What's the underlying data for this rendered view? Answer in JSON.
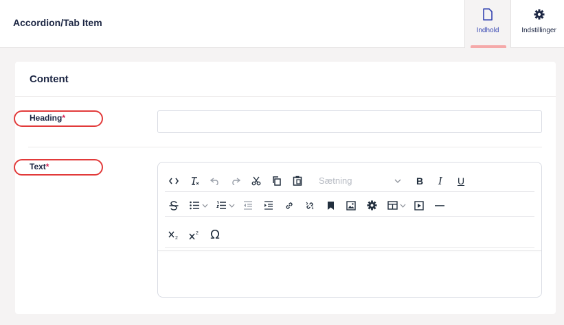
{
  "header": {
    "title": "Accordion/Tab Item",
    "tabs": [
      {
        "label": "Indhold",
        "icon": "document-icon",
        "active": true
      },
      {
        "label": "Indstillinger",
        "icon": "gear-icon",
        "active": false
      }
    ]
  },
  "section": {
    "title": "Content"
  },
  "fields": {
    "heading": {
      "label": "Heading",
      "required_mark": "*",
      "value": ""
    },
    "text": {
      "label": "Text",
      "required_mark": "*"
    }
  },
  "editor": {
    "block_format": "Sætning",
    "toolbar_row1": [
      "source-code-icon",
      "clear-formatting-icon",
      "undo-icon",
      "redo-icon",
      "cut-icon",
      "copy-icon",
      "paste-icon",
      "block-format-select",
      "bold-icon",
      "italic-icon",
      "underline-icon"
    ],
    "toolbar_row2": [
      "strikethrough-icon",
      "bullet-list-icon",
      "numbered-list-icon",
      "outdent-icon",
      "indent-icon",
      "link-icon",
      "unlink-icon",
      "anchor-icon",
      "image-icon",
      "macro-icon",
      "table-icon",
      "media-icon",
      "horizontal-rule-icon"
    ],
    "toolbar_row3": [
      "subscript-icon",
      "superscript-icon",
      "special-character-icon"
    ],
    "glyphs": {
      "bold": "B",
      "italic": "I",
      "underline": "U",
      "omega": "Ω"
    }
  },
  "colors": {
    "accent_blue": "#3544b1",
    "required_red": "#d42054",
    "highlight_ring": "#e23a3a",
    "tab_underline": "#f5a9a9",
    "text_dark": "#1b2542"
  }
}
